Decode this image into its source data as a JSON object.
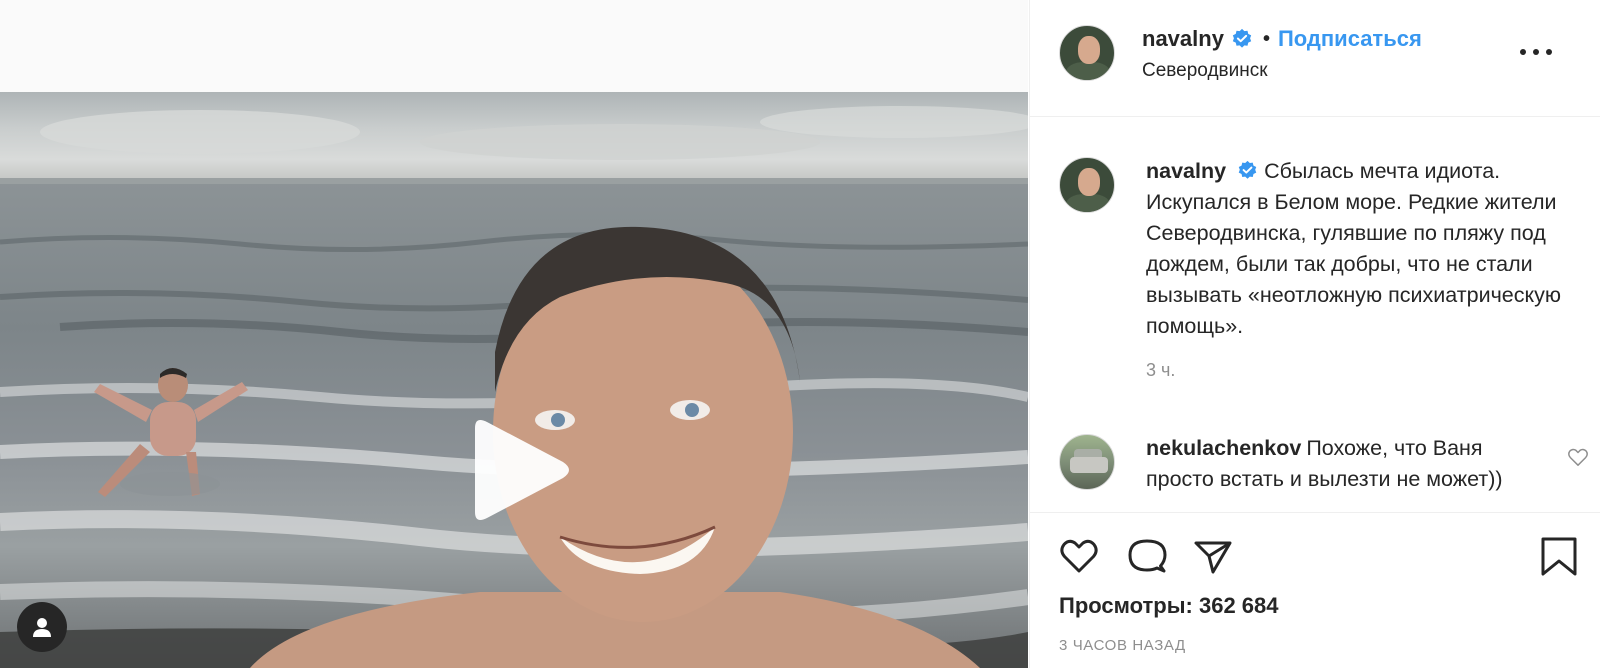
{
  "post": {
    "username": "navalny",
    "separator": "•",
    "follow_label": "Подписаться",
    "location": "Северодвинск"
  },
  "caption": {
    "username": "navalny",
    "text": "Сбылась мечта идиота. Искупался в Белом море. Редкие жители Северодвинска, гулявшие по пляжу под дождем, были так добры, что не стали вызывать «неотложную психиатрическую помощь».",
    "time": "3 ч."
  },
  "comment": {
    "username": "nekulachenkov",
    "text": "Похоже, что Ваня просто встать и вылезти не может))"
  },
  "stats": {
    "views_label": "Просмотры:",
    "views_value": "362 684",
    "posted_ago": "3 часов назад"
  },
  "icons": {
    "verified": "verified-badge-icon",
    "more": "more-options-icon",
    "play": "play-icon",
    "user": "user-tag-icon",
    "like": "heart-icon",
    "comment": "comment-bubble-icon",
    "share": "paper-plane-icon",
    "save": "bookmark-icon",
    "comment_like": "small-heart-icon"
  },
  "colors": {
    "accent": "#3897f0",
    "text": "#262626",
    "muted": "#8e8e8e",
    "border": "#efefef"
  }
}
